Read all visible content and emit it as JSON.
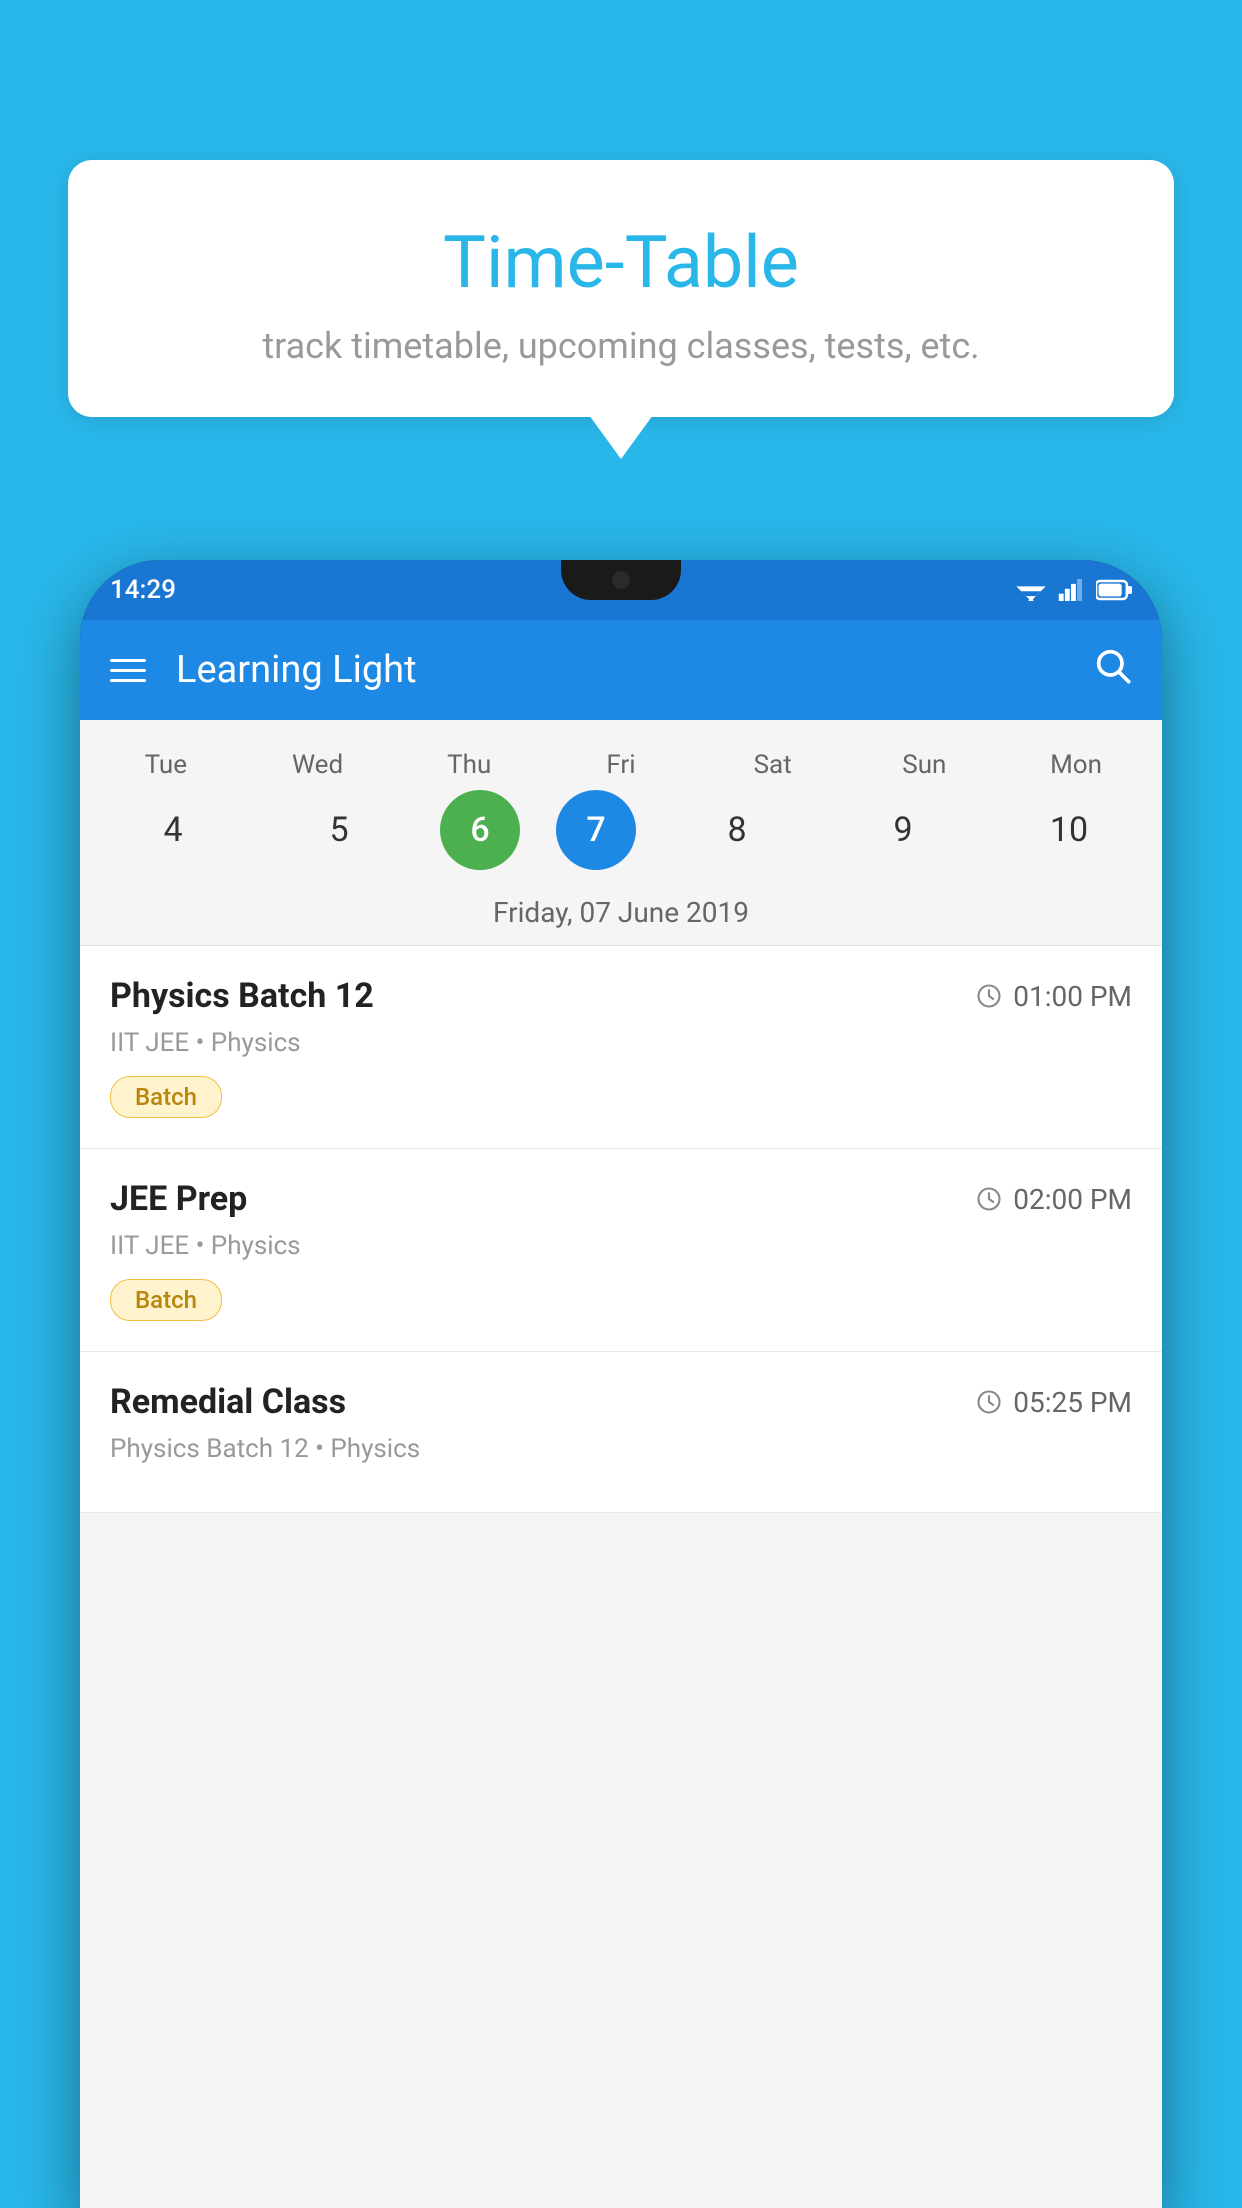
{
  "background": {
    "color": "#29b6e8"
  },
  "tooltip": {
    "title": "Time-Table",
    "subtitle": "track timetable, upcoming classes, tests, etc."
  },
  "phone": {
    "status_bar": {
      "time": "14:29"
    },
    "app_bar": {
      "title": "Learning Light"
    },
    "calendar": {
      "days": [
        {
          "label": "Tue",
          "number": "4"
        },
        {
          "label": "Wed",
          "number": "5"
        },
        {
          "label": "Thu",
          "number": "6",
          "state": "today"
        },
        {
          "label": "Fri",
          "number": "7",
          "state": "selected"
        },
        {
          "label": "Sat",
          "number": "8"
        },
        {
          "label": "Sun",
          "number": "9"
        },
        {
          "label": "Mon",
          "number": "10"
        }
      ],
      "selected_date": "Friday, 07 June 2019"
    },
    "classes": [
      {
        "name": "Physics Batch 12",
        "time": "01:00 PM",
        "meta": "IIT JEE • Physics",
        "badge": "Batch"
      },
      {
        "name": "JEE Prep",
        "time": "02:00 PM",
        "meta": "IIT JEE • Physics",
        "badge": "Batch"
      },
      {
        "name": "Remedial Class",
        "time": "05:25 PM",
        "meta": "Physics Batch 12 • Physics",
        "badge": ""
      }
    ]
  }
}
